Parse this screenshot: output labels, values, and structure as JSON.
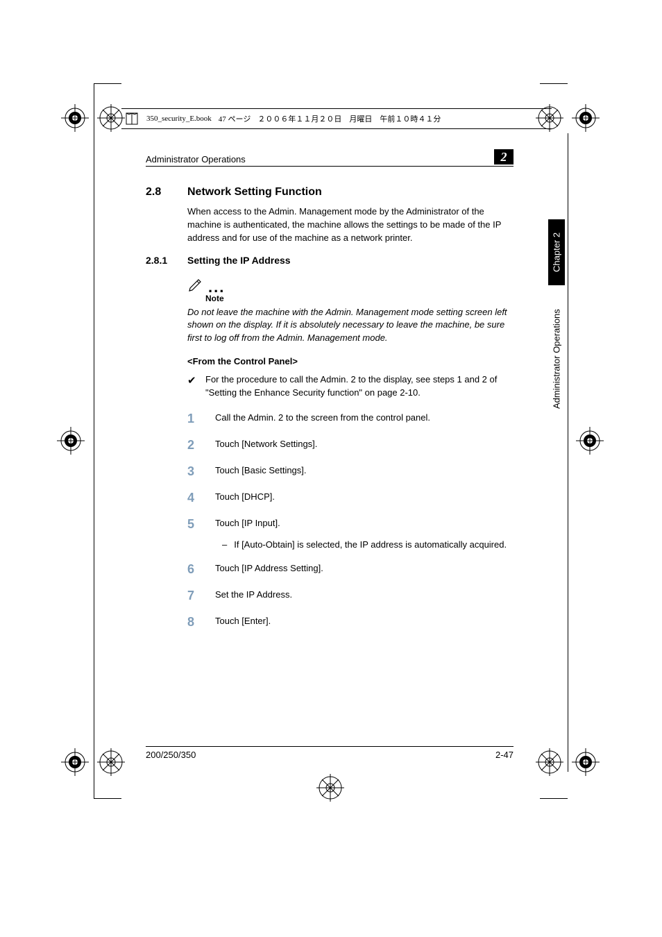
{
  "meta": {
    "file": "350_security_E.book",
    "page_jp": "47 ページ",
    "date_jp": "２００６年１１月２０日　月曜日　午前１０時４１分"
  },
  "header": {
    "running": "Administrator Operations",
    "chapnum": "2"
  },
  "side": {
    "chapter": "Chapter 2",
    "title": "Administrator Operations"
  },
  "section": {
    "num": "2.8",
    "title": "Network Setting Function",
    "body": "When access to the Admin. Management mode by the Administrator of the machine is authenticated, the machine allows the settings to be made of the IP address and for use of the machine as a network printer."
  },
  "subsection": {
    "num": "2.8.1",
    "title": "Setting the IP Address"
  },
  "note": {
    "label": "Note",
    "text": "Do not leave the machine with the Admin. Management mode setting screen left shown on the display. If it is absolutely necessary to leave the machine, be sure first to log off from the Admin. Management mode."
  },
  "panel_head": "<From the Control Panel>",
  "check": "For the procedure to call the Admin. 2 to the display, see steps 1 and 2 of \"Setting the Enhance Security function\" on page 2-10.",
  "steps": [
    "Call the Admin. 2 to the screen from the control panel.",
    "Touch [Network Settings].",
    "Touch [Basic Settings].",
    "Touch [DHCP].",
    "Touch [IP Input].",
    "Touch [IP Address Setting].",
    "Set the IP Address.",
    "Touch [Enter]."
  ],
  "step5_sub": "If [Auto-Obtain] is selected, the IP address is automatically acquired.",
  "footer": {
    "left": "200/250/350",
    "right": "2-47"
  }
}
